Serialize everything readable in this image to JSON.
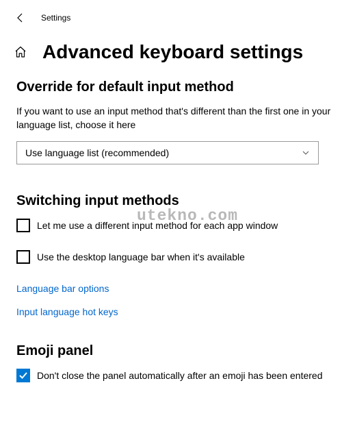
{
  "header": {
    "appTitle": "Settings"
  },
  "page": {
    "title": "Advanced keyboard settings"
  },
  "override": {
    "heading": "Override for default input method",
    "description": "If you want to use an input method that's different than the first one in your language list, choose it here",
    "dropdownValue": "Use language list (recommended)"
  },
  "switching": {
    "heading": "Switching input methods",
    "option1": "Let me use a different input method for each app window",
    "option1Checked": false,
    "option2": "Use the desktop language bar when it's available",
    "option2Checked": false,
    "link1": "Language bar options",
    "link2": "Input language hot keys"
  },
  "emoji": {
    "heading": "Emoji panel",
    "option1": "Don't close the panel automatically after an emoji has been entered",
    "option1Checked": true
  },
  "watermark": "utekno.com"
}
